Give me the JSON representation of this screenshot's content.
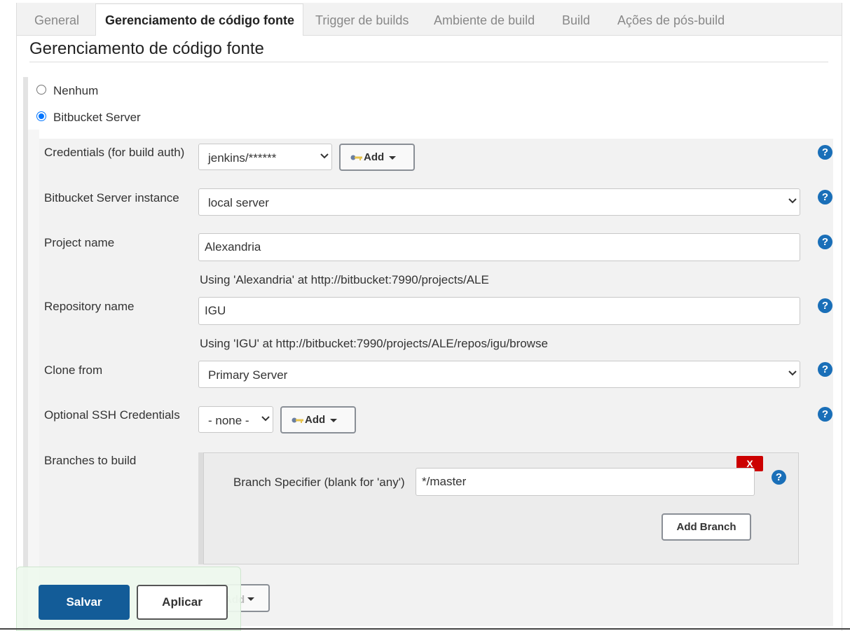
{
  "tabs": [
    {
      "label": "General"
    },
    {
      "label": "Gerenciamento de código fonte"
    },
    {
      "label": "Trigger de builds"
    },
    {
      "label": "Ambiente de build"
    },
    {
      "label": "Build"
    },
    {
      "label": "Ações de pós-build"
    }
  ],
  "active_tab": "Gerenciamento de código fonte",
  "section_title": "Gerenciamento de código fonte",
  "scm_options": [
    {
      "label": "Nenhum",
      "checked": false
    },
    {
      "label": "Bitbucket Server",
      "checked": true
    }
  ],
  "form": {
    "credentials": {
      "label": "Credentials (for build auth)",
      "value": "jenkins/******",
      "add_label": "Add"
    },
    "server_instance": {
      "label": "Bitbucket Server instance",
      "value": "local server"
    },
    "project": {
      "label": "Project name",
      "value": "Alexandria",
      "hint": "Using 'Alexandria' at http://bitbucket:7990/projects/ALE"
    },
    "repository": {
      "label": "Repository name",
      "value": "IGU",
      "hint": "Using 'IGU' at http://bitbucket:7990/projects/ALE/repos/igu/browse"
    },
    "clone_from": {
      "label": "Clone from",
      "value": "Primary Server"
    },
    "ssh_credentials": {
      "label": "Optional SSH Credentials",
      "value": "- none -",
      "add_label": "Add"
    },
    "branches": {
      "label": "Branches to build",
      "specifier_label": "Branch Specifier (blank for 'any')",
      "specifier_value": "*/master",
      "delete_label": "X",
      "add_branch_label": "Add Branch"
    }
  },
  "help_icon_glyph": "?",
  "bottom_add_label": "Add",
  "actions": {
    "save_label": "Salvar",
    "apply_label": "Aplicar"
  },
  "colors": {
    "primary_button": "#135c98",
    "help_icon": "#1a6fb8",
    "delete_button": "#cc0000",
    "radio_checked": "#0075ff"
  }
}
